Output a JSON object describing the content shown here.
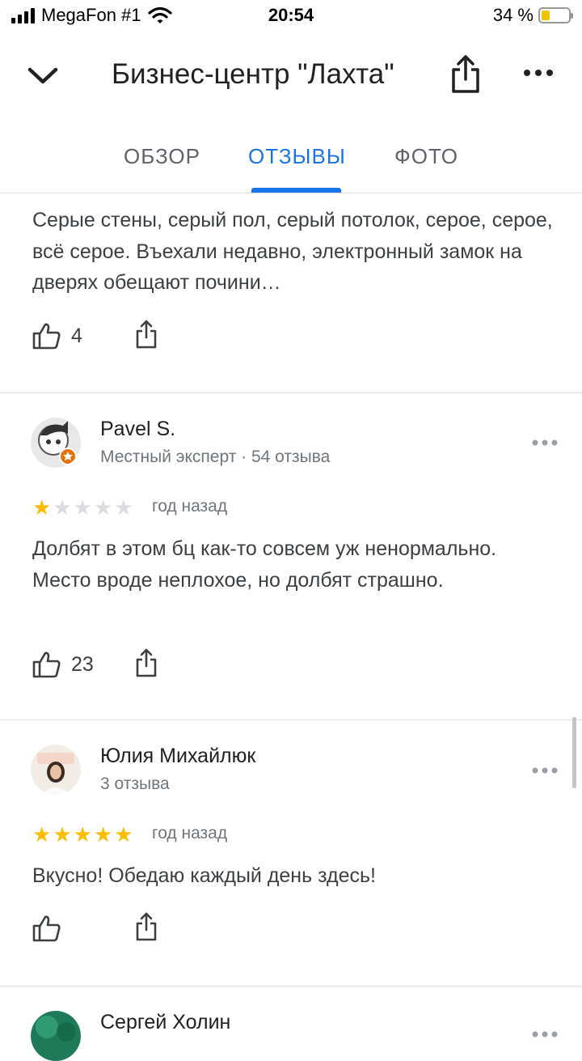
{
  "status_bar": {
    "carrier": "MegaFon #1",
    "time": "20:54",
    "battery": "34 %",
    "battery_level": 0.34
  },
  "header": {
    "title": "Бизнес-центр \"Лахта\""
  },
  "tabs": [
    {
      "label": "ОБЗОР",
      "active": false
    },
    {
      "label": "ОТЗЫВЫ",
      "active": true
    },
    {
      "label": "ФОТО",
      "active": false
    }
  ],
  "colors": {
    "accent": "#1a73e8",
    "star": "#fbbc04"
  },
  "reviews": [
    {
      "text": "Серые стены, серый пол, серый потолок, серое, серое, всё серое. Въехали недавно, электронный замок на дверях обещают почини…",
      "likes": "4"
    },
    {
      "author": "Pavel S.",
      "meta": "Местный эксперт · 54 отзыва",
      "rating": 1,
      "when": "год назад",
      "text": "Долбят в этом бц как-то совсем уж ненормально. Место вроде неплохое, но долбят страшно.",
      "likes": "23"
    },
    {
      "author": "Юлия Михайлюк",
      "meta": "3 отзыва",
      "rating": 5,
      "when": "год назад",
      "text": "Вкусно! Обедаю каждый день здесь!",
      "likes": ""
    },
    {
      "author": "Сергей Холин"
    }
  ]
}
